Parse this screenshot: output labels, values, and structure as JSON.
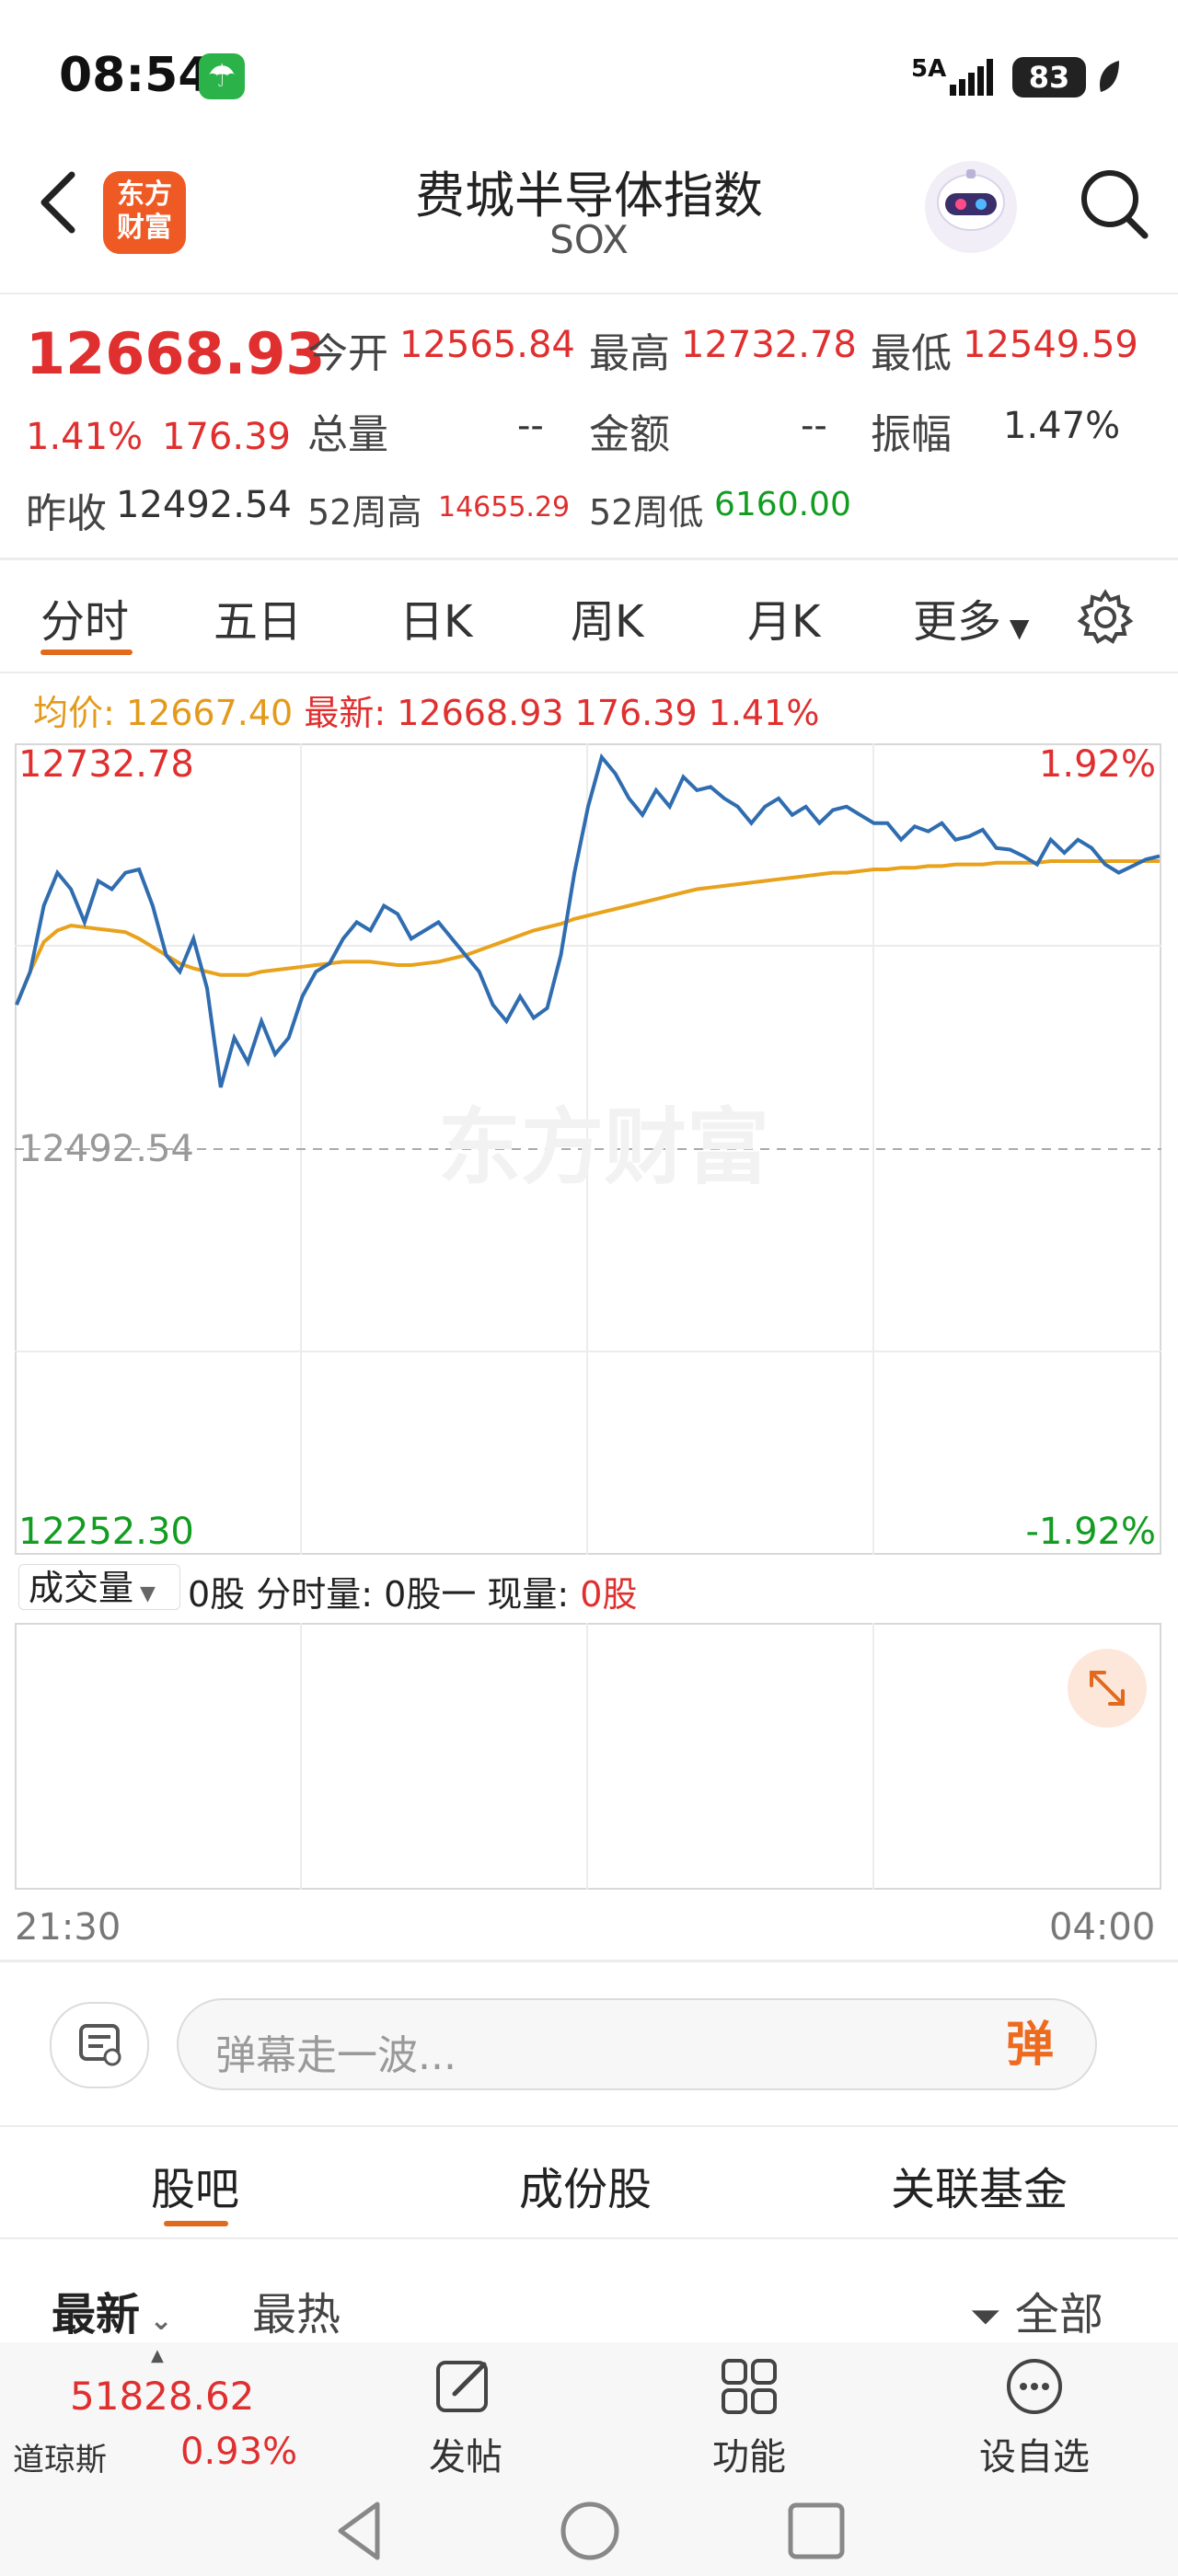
{
  "status_bar": {
    "time": "08:54",
    "signal": "5A",
    "battery": "83"
  },
  "header": {
    "back_icon": "chevron-left-icon",
    "logo_text_line1": "东方",
    "logo_text_line2": "财富",
    "title": "费城半导体指数",
    "subtitle": "SOX",
    "search_icon": "search-icon"
  },
  "quote": {
    "last_price": "12668.93",
    "change_pct": "1.41%",
    "change_abs": "176.39",
    "prev_close_label": "昨收",
    "prev_close": "12492.54",
    "open_label": "今开",
    "open": "12565.84",
    "high_label": "最高",
    "high": "12732.78",
    "low_label": "最低",
    "low": "12549.59",
    "volume_label": "总量",
    "volume": "--",
    "amount_label": "金额",
    "amount": "--",
    "amplitude_label": "振幅",
    "amplitude": "1.47%",
    "week52_high_label": "52周高",
    "week52_high": "14655.29",
    "week52_low_label": "52周低",
    "week52_low": "6160.00"
  },
  "period_tabs": [
    "分时",
    "五日",
    "日K",
    "周K",
    "月K",
    "更多"
  ],
  "info_line": {
    "avg_label": "均价:",
    "avg_value": "12667.40",
    "latest_label": "最新:",
    "latest_value": "12668.93",
    "latest_change": "176.39",
    "latest_pct": "1.41%"
  },
  "chart_data": {
    "type": "line",
    "y_max_label": "12732.78",
    "y_mid_label": "12492.54",
    "y_min_label": "12252.30",
    "pct_max_label": "1.92%",
    "pct_min_label": "-1.92%",
    "ylim": [
      12252.3,
      12732.78
    ],
    "prev_close": 12492.54,
    "time_start": "21:30",
    "time_end": "04:00",
    "watermark": "东方财富",
    "series": [
      {
        "name": "最新",
        "color": "#2f6db0",
        "values": [
          12580,
          12600,
          12640,
          12660,
          12650,
          12630,
          12655,
          12650,
          12660,
          12662,
          12640,
          12610,
          12600,
          12620,
          12590,
          12530,
          12560,
          12545,
          12570,
          12550,
          12560,
          12585,
          12600,
          12605,
          12620,
          12630,
          12625,
          12640,
          12635,
          12620,
          12625,
          12630,
          12620,
          12610,
          12600,
          12580,
          12570,
          12585,
          12572,
          12578,
          12610,
          12660,
          12700,
          12730,
          12720,
          12705,
          12695,
          12710,
          12700,
          12718,
          12710,
          12712,
          12705,
          12700,
          12690,
          12700,
          12705,
          12695,
          12700,
          12690,
          12698,
          12700,
          12695,
          12690,
          12690,
          12680,
          12688,
          12685,
          12690,
          12680,
          12682,
          12686,
          12675,
          12674,
          12670,
          12665,
          12680,
          12672,
          12680,
          12675,
          12665,
          12660,
          12664,
          12668,
          12670
        ]
      },
      {
        "name": "均价",
        "color": "#e8a21c",
        "values": [
          12580,
          12600,
          12618,
          12625,
          12628,
          12627,
          12626,
          12625,
          12624,
          12620,
          12615,
          12610,
          12605,
          12602,
          12600,
          12598,
          12598,
          12598,
          12600,
          12601,
          12602,
          12603,
          12604,
          12605,
          12606,
          12606,
          12606,
          12605,
          12604,
          12604,
          12605,
          12606,
          12608,
          12610,
          12613,
          12616,
          12619,
          12622,
          12625,
          12627,
          12629,
          12632,
          12634,
          12636,
          12638,
          12640,
          12642,
          12644,
          12646,
          12648,
          12650,
          12651,
          12652,
          12653,
          12654,
          12655,
          12656,
          12657,
          12658,
          12659,
          12660,
          12660,
          12661,
          12662,
          12662,
          12663,
          12663,
          12664,
          12664,
          12665,
          12665,
          12665,
          12666,
          12666,
          12666,
          12666,
          12667,
          12667,
          12667,
          12667,
          12667,
          12667,
          12667,
          12667,
          12667
        ]
      }
    ]
  },
  "volume_section": {
    "selector_label": "成交量",
    "text": "0股 分时量:  0股一 现量: ",
    "current": "0股",
    "expand_icon": "expand-icon"
  },
  "danmu": {
    "placeholder": "弹幕走一波...",
    "send_label": "弹"
  },
  "bottom_tabs": [
    "股吧",
    "成份股",
    "关联基金"
  ],
  "sort_tabs": {
    "latest": "最新",
    "hot": "最热",
    "filter": "全部"
  },
  "bottom_nav": {
    "index_value": "51828.62",
    "index_name": "道琼斯",
    "index_pct": "0.93%",
    "post_label": "发帖",
    "function_label": "功能",
    "watchlist_label": "设自选"
  }
}
